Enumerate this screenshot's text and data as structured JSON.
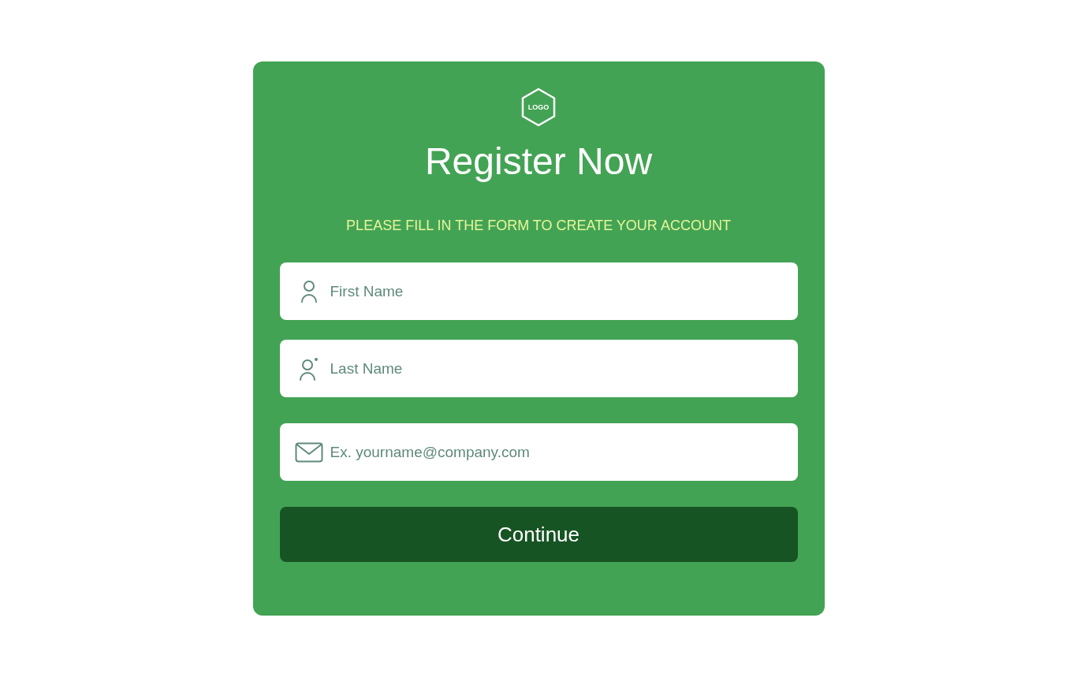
{
  "logo": {
    "text": "LOGO"
  },
  "title": "Register Now",
  "subtitle": "PLEASE FILL IN THE FORM TO CREATE YOUR ACCOUNT",
  "fields": [
    {
      "kind": "person",
      "placeholder": "First Name"
    },
    {
      "kind": "person-dot",
      "placeholder": "Last Name"
    },
    {
      "kind": "email",
      "placeholder": "Ex. yourname@company.com"
    }
  ],
  "button": "Continue"
}
